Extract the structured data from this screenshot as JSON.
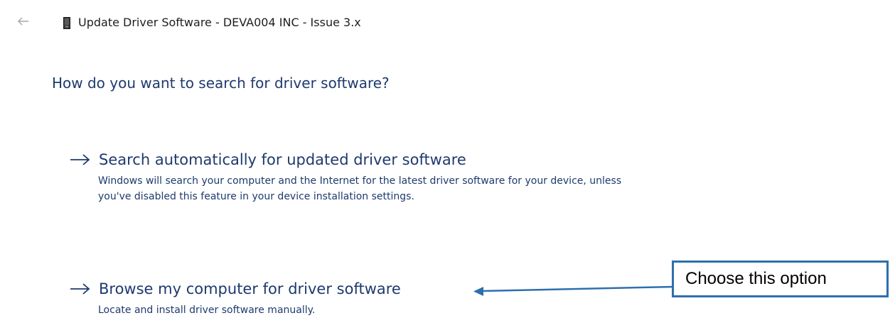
{
  "window": {
    "title": "Update Driver Software - DEVA004 INC - Issue 3.x",
    "back_icon": "back-arrow-icon",
    "device_icon": "device-icon"
  },
  "main": {
    "heading": "How do you want to search for driver software?",
    "options": [
      {
        "title": "Search automatically for updated driver software",
        "description": "Windows will search your computer and the Internet for the latest driver software for your device, unless you've disabled this feature in your device installation settings."
      },
      {
        "title": "Browse my computer for driver software",
        "description": "Locate and install driver software manually."
      }
    ]
  },
  "annotation": {
    "callout_text": "Choose this option"
  },
  "colors": {
    "link_blue": "#1e3a6e",
    "callout_border": "#2e6fad"
  }
}
